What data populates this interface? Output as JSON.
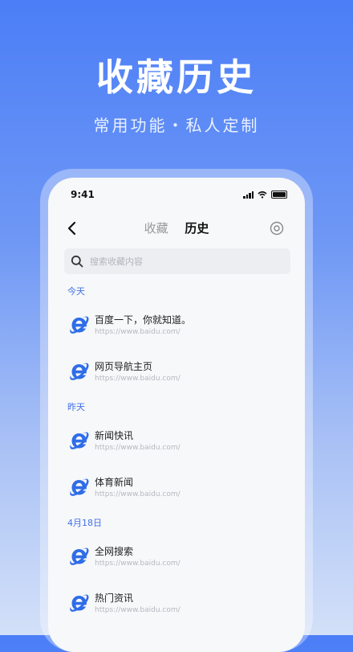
{
  "hero": {
    "title": "收藏历史",
    "subtitle": "常用功能・私人定制"
  },
  "status_bar": {
    "time": "9:41"
  },
  "nav": {
    "tabs": [
      {
        "label": "收藏"
      },
      {
        "label": "历史"
      }
    ],
    "active_tab": "历史"
  },
  "search": {
    "placeholder": "搜索收藏内容"
  },
  "groups": [
    {
      "label": "今天",
      "items": [
        {
          "title": "百度一下，你就知道。",
          "url": "https://www.baidu.com/"
        },
        {
          "title": "网页导航主页",
          "url": "https://www.baidu.com/"
        }
      ]
    },
    {
      "label": "昨天",
      "items": [
        {
          "title": "新闻快讯",
          "url": "https://www.baidu.com/"
        },
        {
          "title": "体育新闻",
          "url": "https://www.baidu.com/"
        }
      ]
    },
    {
      "label": "4月18日",
      "items": [
        {
          "title": "全网搜索",
          "url": "https://www.baidu.com/"
        },
        {
          "title": "热门资讯",
          "url": "https://www.baidu.com/"
        }
      ]
    }
  ],
  "colors": {
    "accent": "#3f6fe8",
    "background_top": "#4b7ef7",
    "ie_icon": "#2f6de8"
  }
}
